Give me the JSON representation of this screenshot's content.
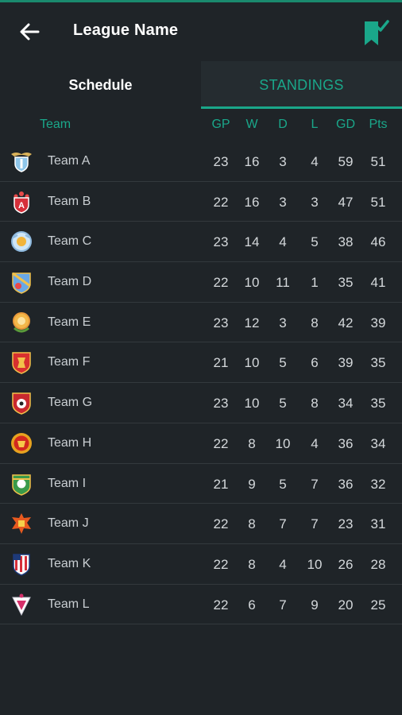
{
  "app": {
    "title": "League Name"
  },
  "tabs": [
    {
      "label": "Schedule",
      "active": false
    },
    {
      "label": "STANDINGS",
      "active": true
    }
  ],
  "colors": {
    "accent": "#1aa78a",
    "background": "#1f2428"
  },
  "icons": {
    "back": "arrow-left-icon",
    "bookmark": "bookmark-check-icon"
  },
  "table": {
    "headers": {
      "team": "Team",
      "gp": "GP",
      "w": "W",
      "d": "D",
      "l": "L",
      "gd": "GD",
      "pts": "Pts"
    },
    "rows": [
      {
        "team": "Team A",
        "gp": "23",
        "w": "16",
        "d": "3",
        "l": "4",
        "gd": "59",
        "pts": "51",
        "crest": "crest-a-icon"
      },
      {
        "team": "Team B",
        "gp": "22",
        "w": "16",
        "d": "3",
        "l": "3",
        "gd": "47",
        "pts": "51",
        "crest": "crest-b-icon"
      },
      {
        "team": "Team C",
        "gp": "23",
        "w": "14",
        "d": "4",
        "l": "5",
        "gd": "38",
        "pts": "46",
        "crest": "crest-c-icon"
      },
      {
        "team": "Team D",
        "gp": "22",
        "w": "10",
        "d": "11",
        "l": "1",
        "gd": "35",
        "pts": "41",
        "crest": "crest-d-icon"
      },
      {
        "team": "Team E",
        "gp": "23",
        "w": "12",
        "d": "3",
        "l": "8",
        "gd": "42",
        "pts": "39",
        "crest": "crest-e-icon"
      },
      {
        "team": "Team  F",
        "gp": "21",
        "w": "10",
        "d": "5",
        "l": "6",
        "gd": "39",
        "pts": "35",
        "crest": "crest-f-icon"
      },
      {
        "team": "Team G",
        "gp": "23",
        "w": "10",
        "d": "5",
        "l": "8",
        "gd": "34",
        "pts": "35",
        "crest": "crest-g-icon"
      },
      {
        "team": "Team H",
        "gp": "22",
        "w": "8",
        "d": "10",
        "l": "4",
        "gd": "36",
        "pts": "34",
        "crest": "crest-h-icon"
      },
      {
        "team": "Team I",
        "gp": "21",
        "w": "9",
        "d": "5",
        "l": "7",
        "gd": "36",
        "pts": "32",
        "crest": "crest-i-icon"
      },
      {
        "team": "Team J",
        "gp": "22",
        "w": "8",
        "d": "7",
        "l": "7",
        "gd": "23",
        "pts": "31",
        "crest": "crest-j-icon"
      },
      {
        "team": "Team K",
        "gp": "22",
        "w": "8",
        "d": "4",
        "l": "10",
        "gd": "26",
        "pts": "28",
        "crest": "crest-k-icon"
      },
      {
        "team": "Team L",
        "gp": "22",
        "w": "6",
        "d": "7",
        "l": "9",
        "gd": "20",
        "pts": "25",
        "crest": "crest-l-icon"
      }
    ]
  }
}
